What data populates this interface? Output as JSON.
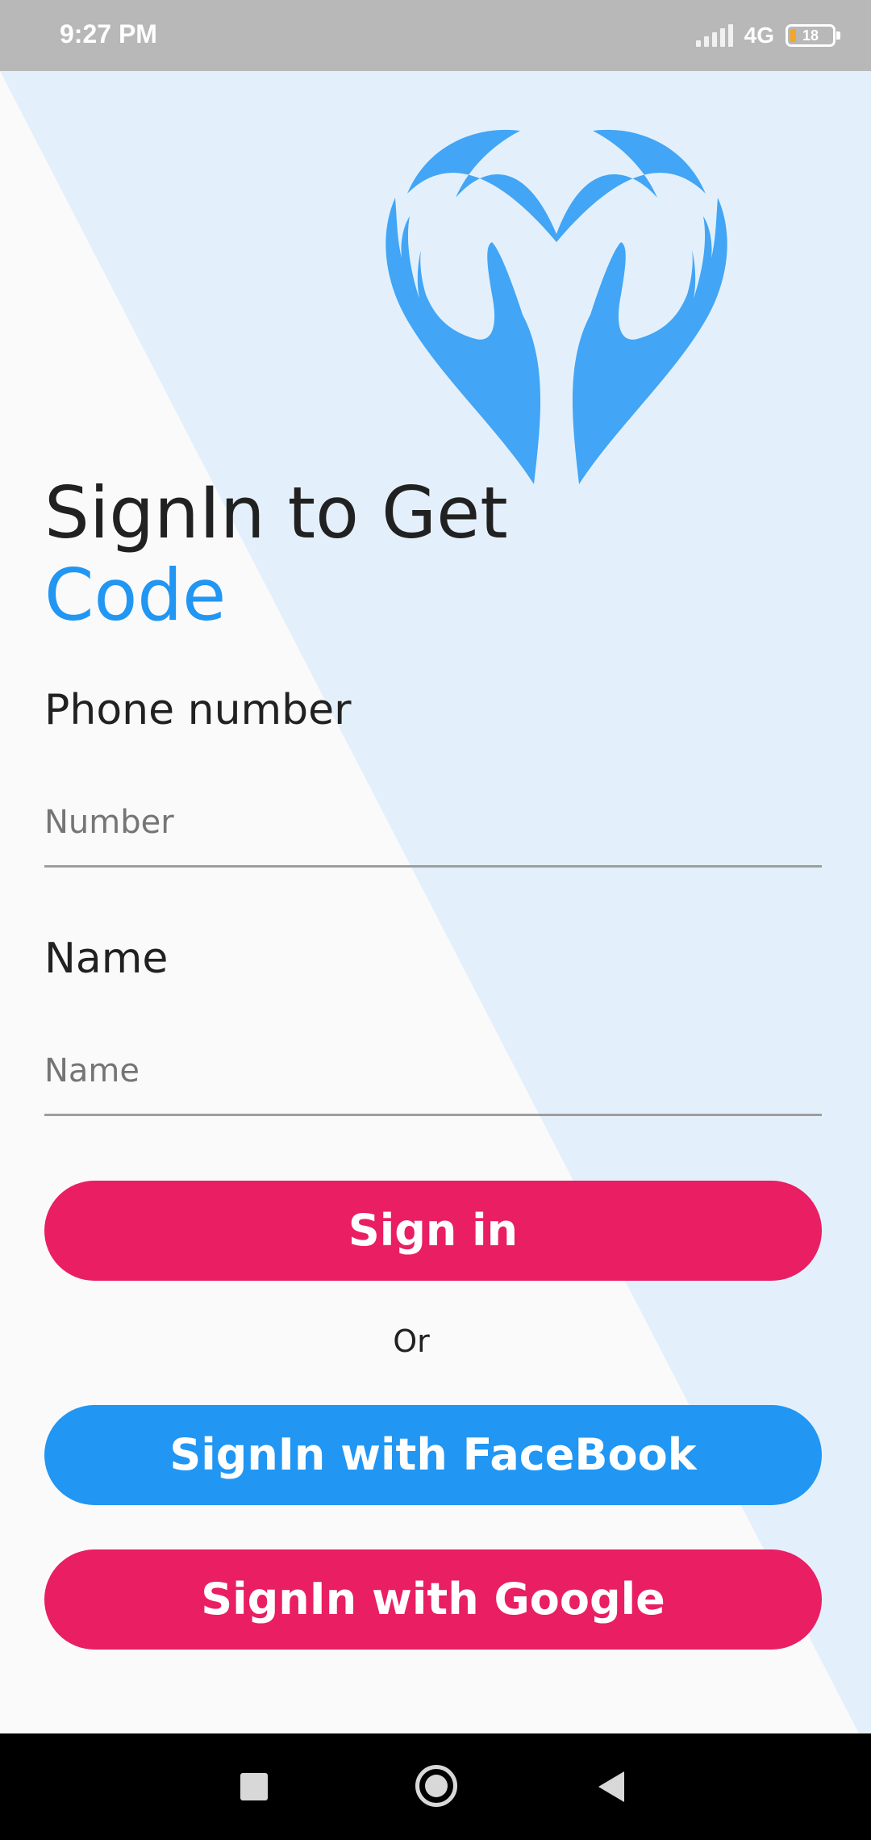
{
  "status_bar": {
    "time": "9:27 PM",
    "network": "4G",
    "battery_level": "18"
  },
  "colors": {
    "accent_blue": "#2196f3",
    "accent_pink": "#e91e63",
    "background_light_blue": "#e3f0fb",
    "logo_blue": "#42a5f5"
  },
  "logo": {
    "icon": "heart-hands-icon"
  },
  "heading": {
    "line1": "SignIn to Get",
    "line2": "Code"
  },
  "form": {
    "phone_label": "Phone number",
    "phone_placeholder": "Number",
    "phone_value": "",
    "name_label": "Name",
    "name_placeholder": "Name",
    "name_value": ""
  },
  "actions": {
    "sign_in": "Sign in",
    "or": "Or",
    "facebook": "SignIn with FaceBook",
    "google": "SignIn with Google"
  },
  "nav_bar": {
    "recents_icon": "square-icon",
    "home_icon": "circle-icon",
    "back_icon": "triangle-back-icon"
  }
}
